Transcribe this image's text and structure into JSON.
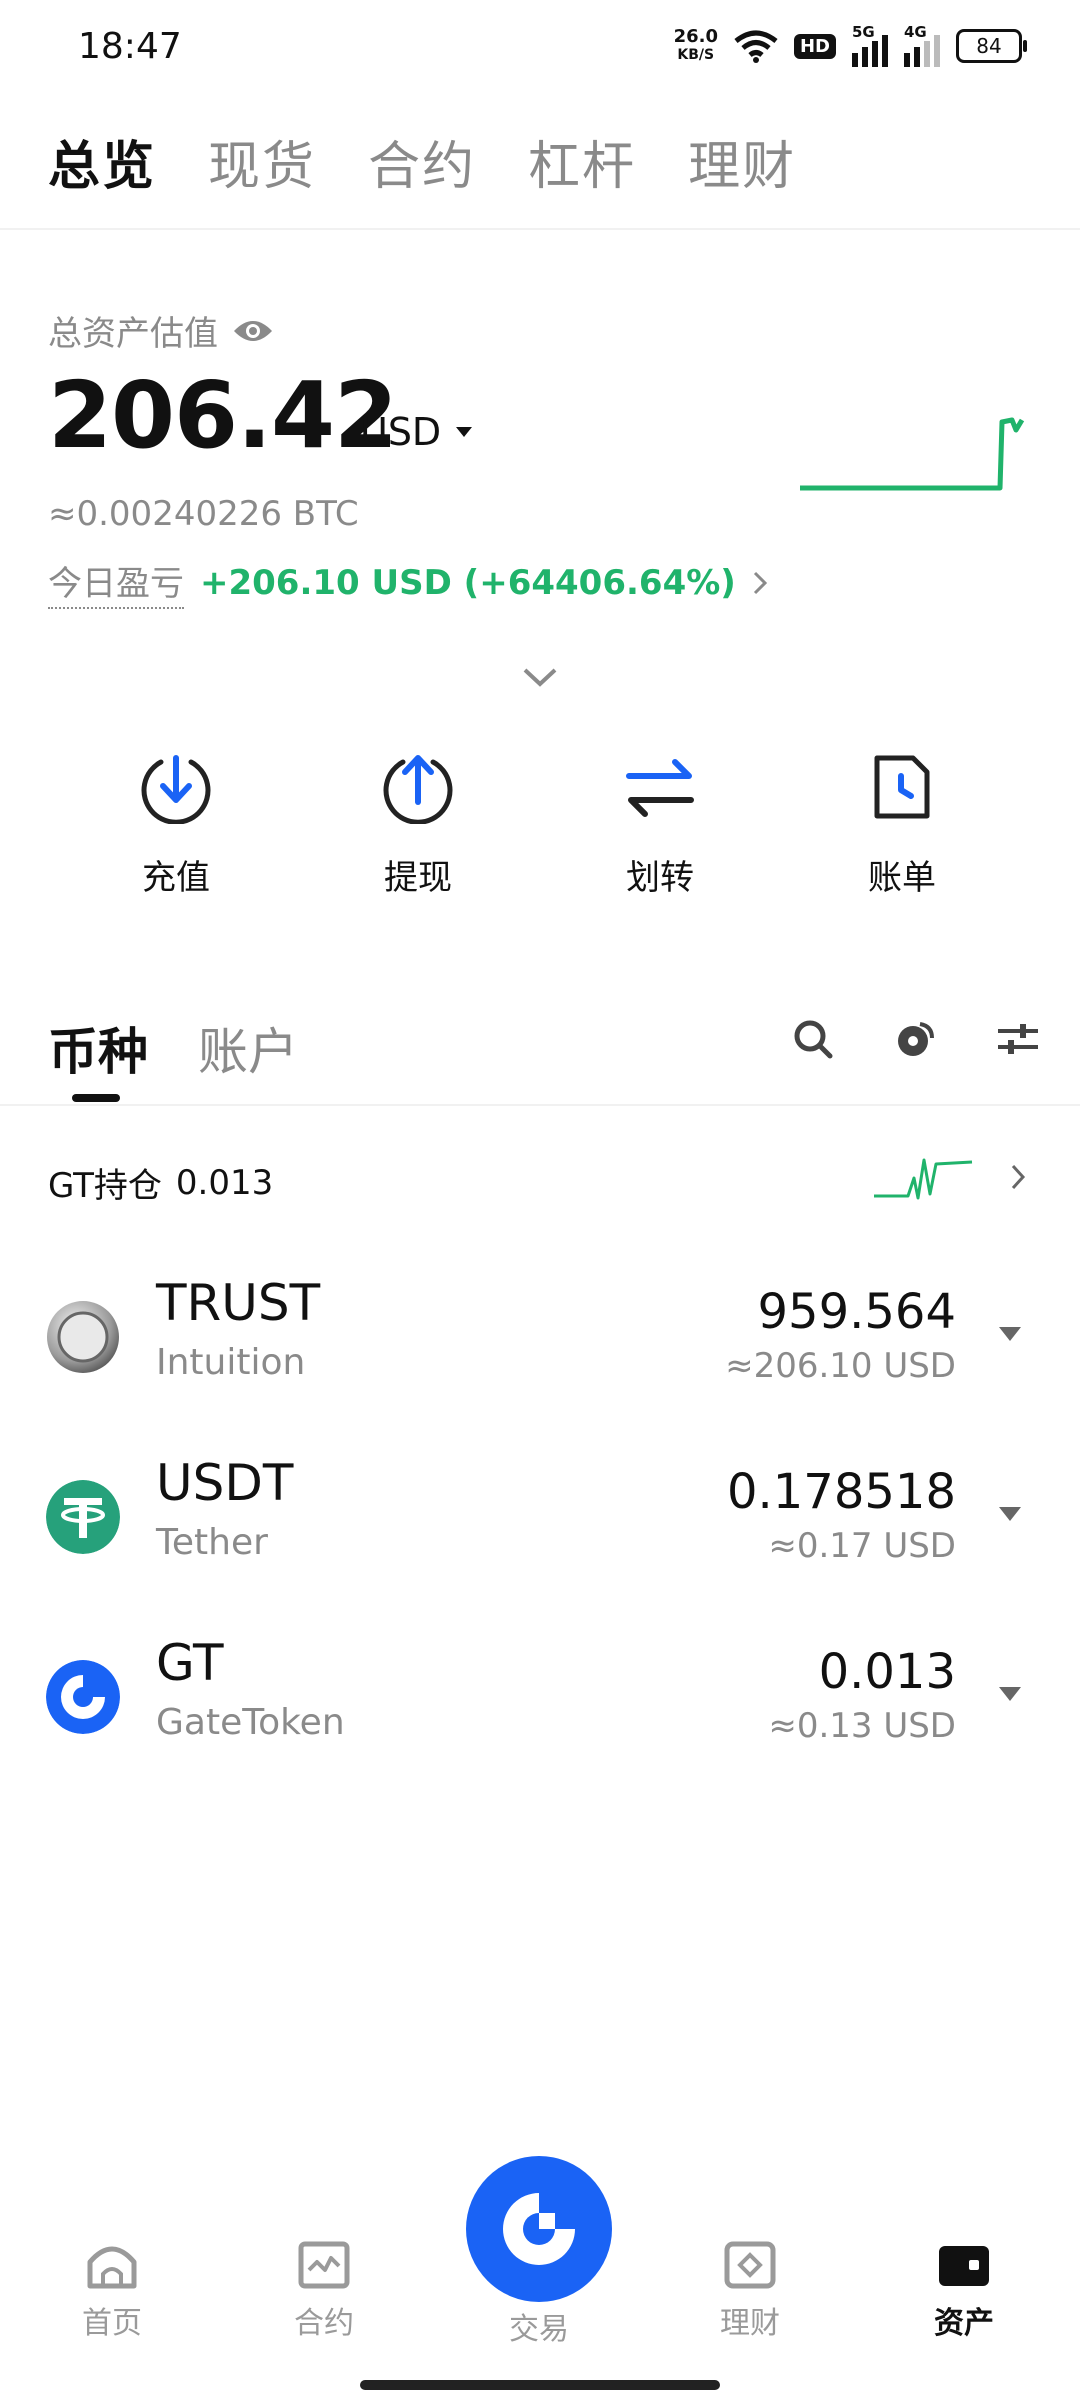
{
  "status": {
    "time": "18:47",
    "net_speed_value": "26.0",
    "net_speed_unit": "KB/S",
    "hd_badge": "HD",
    "sig1_label": "5G",
    "sig2_label": "4G",
    "battery": "84"
  },
  "top_tabs": [
    {
      "label": "总览",
      "active": true
    },
    {
      "label": "现货"
    },
    {
      "label": "合约"
    },
    {
      "label": "杠杆"
    },
    {
      "label": "理财"
    }
  ],
  "asset": {
    "label": "总资产估值",
    "value": "206.42",
    "unit": "USD",
    "btc": "≈0.00240226 BTC",
    "pnl_label": "今日盈亏",
    "pnl_value": "+206.10 USD (+64406.64%)"
  },
  "actions": [
    {
      "label": "充值",
      "icon": "deposit-icon"
    },
    {
      "label": "提现",
      "icon": "withdraw-icon"
    },
    {
      "label": "划转",
      "icon": "transfer-icon"
    },
    {
      "label": "账单",
      "icon": "bill-icon"
    }
  ],
  "section_tabs": [
    {
      "label": "币种",
      "active": true
    },
    {
      "label": "账户"
    }
  ],
  "gt_holding": {
    "label": "GT持仓",
    "value": "0.013"
  },
  "coins": [
    {
      "symbol": "TRUST",
      "name": "Intuition",
      "amount": "959.564",
      "usd": "≈206.10 USD"
    },
    {
      "symbol": "USDT",
      "name": "Tether",
      "amount": "0.178518",
      "usd": "≈0.17 USD"
    },
    {
      "symbol": "GT",
      "name": "GateToken",
      "amount": "0.013",
      "usd": "≈0.13 USD"
    }
  ],
  "nav": [
    {
      "label": "首页"
    },
    {
      "label": "合约"
    },
    {
      "label": "交易"
    },
    {
      "label": "理财"
    },
    {
      "label": "资产",
      "active": true
    }
  ],
  "colors": {
    "accent": "#1a63f5",
    "positive": "#20b36b",
    "muted": "#8a8a8a"
  }
}
